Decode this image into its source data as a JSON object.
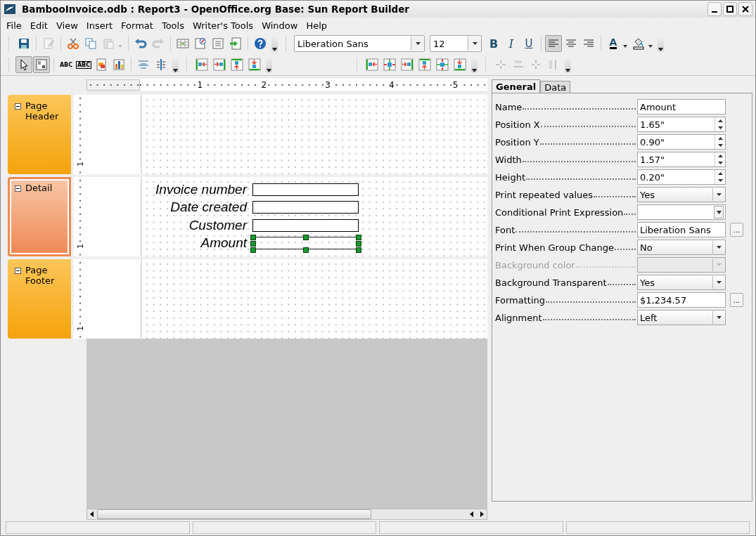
{
  "window": {
    "title": "BambooInvoice.odb : Report3 - OpenOffice.org Base: Sun Report Builder"
  },
  "menu": [
    {
      "label": "File"
    },
    {
      "label": "Edit"
    },
    {
      "label": "View"
    },
    {
      "label": "Insert"
    },
    {
      "label": "Format"
    },
    {
      "label": "Tools"
    },
    {
      "label": "Writer's Tools"
    },
    {
      "label": "Window"
    },
    {
      "label": "Help"
    }
  ],
  "toolbars": [
    {
      "items": [
        {
          "kind": "grip"
        },
        {
          "kind": "save",
          "disabled": false,
          "selected": false
        },
        {
          "kind": "separator"
        },
        {
          "kind": "edit",
          "disabled": true,
          "selected": false
        },
        {
          "kind": "separator"
        },
        {
          "kind": "cut",
          "disabled": false,
          "selected": false
        },
        {
          "kind": "copy",
          "disabled": false,
          "selected": false
        },
        {
          "kind": "paste",
          "disabled": true,
          "selected": false,
          "dropdown": true
        },
        {
          "kind": "separator"
        },
        {
          "kind": "undo",
          "disabled": false,
          "selected": false
        },
        {
          "kind": "redo",
          "disabled": true,
          "selected": false
        },
        {
          "kind": "separator"
        },
        {
          "kind": "table",
          "disabled": false,
          "selected": false
        },
        {
          "kind": "navigator",
          "disabled": false,
          "selected": false
        },
        {
          "kind": "page",
          "disabled": false,
          "selected": false
        },
        {
          "kind": "import",
          "disabled": false,
          "selected": false
        },
        {
          "kind": "separator"
        },
        {
          "kind": "help",
          "disabled": false,
          "selected": false
        },
        {
          "kind": "more"
        },
        {
          "kind": "grip"
        },
        {
          "kind": "combo",
          "value": "Liberation Sans"
        },
        {
          "kind": "combo",
          "value": "12"
        },
        {
          "kind": "bold",
          "label": "B",
          "disabled": false,
          "selected": false
        },
        {
          "kind": "italic",
          "label": "I",
          "disabled": false,
          "selected": false
        },
        {
          "kind": "underline",
          "label": "U",
          "disabled": false,
          "selected": false
        },
        {
          "kind": "separator"
        },
        {
          "kind": "align-left",
          "disabled": false,
          "selected": true
        },
        {
          "kind": "align-center",
          "disabled": false,
          "selected": false
        },
        {
          "kind": "align-right",
          "disabled": false,
          "selected": false
        },
        {
          "kind": "separator"
        },
        {
          "kind": "font-color",
          "label": "A",
          "disabled": false,
          "selected": false,
          "dropdown": true
        },
        {
          "kind": "highlight",
          "disabled": false,
          "selected": false,
          "dropdown": true
        },
        {
          "kind": "more"
        }
      ]
    },
    {
      "items": [
        {
          "kind": "grip"
        },
        {
          "kind": "select",
          "disabled": false,
          "selected": true
        },
        {
          "kind": "group",
          "disabled": false,
          "selected": true
        },
        {
          "kind": "separator"
        },
        {
          "kind": "label",
          "label": "ABC",
          "disabled": false,
          "selected": false
        },
        {
          "kind": "field",
          "label": "ABC",
          "disabled": false,
          "selected": false
        },
        {
          "kind": "image",
          "disabled": false,
          "selected": false
        },
        {
          "kind": "chart",
          "disabled": false,
          "selected": false
        },
        {
          "kind": "separator"
        },
        {
          "kind": "center-lines",
          "disabled": false,
          "selected": false
        },
        {
          "kind": "vertical-lines",
          "disabled": false,
          "selected": false
        },
        {
          "kind": "more"
        },
        {
          "kind": "grip"
        },
        {
          "kind": "align-to-left",
          "disabled": false,
          "selected": false
        },
        {
          "kind": "align-to-right",
          "disabled": false,
          "selected": false
        },
        {
          "kind": "align-to-top",
          "disabled": false,
          "selected": false
        },
        {
          "kind": "align-to-bottom",
          "disabled": false,
          "selected": false
        },
        {
          "kind": "more"
        },
        {
          "kind": "spacer"
        },
        {
          "kind": "grip"
        },
        {
          "kind": "align-to-left",
          "disabled": false,
          "selected": false
        },
        {
          "kind": "shrink-width",
          "disabled": false,
          "selected": false
        },
        {
          "kind": "align-to-right",
          "disabled": false,
          "selected": false
        },
        {
          "kind": "align-to-top",
          "disabled": false,
          "selected": false
        },
        {
          "kind": "shrink-height",
          "disabled": false,
          "selected": false
        },
        {
          "kind": "align-to-bottom",
          "disabled": false,
          "selected": false
        },
        {
          "kind": "more"
        },
        {
          "kind": "grip"
        },
        {
          "kind": "join-horizontal",
          "disabled": true,
          "selected": false
        },
        {
          "kind": "equal-width",
          "disabled": true,
          "selected": false
        },
        {
          "kind": "join-vertical",
          "disabled": true,
          "selected": false
        },
        {
          "kind": "equal-height",
          "disabled": true,
          "selected": false
        },
        {
          "kind": "more"
        }
      ]
    }
  ],
  "ruler": {
    "marks": [
      "1",
      "2",
      "3",
      "4",
      "5"
    ]
  },
  "sections": [
    {
      "title": "Page Header",
      "expanded": true,
      "selected": false,
      "ruler_mark": "1"
    },
    {
      "title": "Detail",
      "expanded": true,
      "selected": true,
      "ruler_mark": "1",
      "controls": [
        {
          "label": "Invoice number",
          "selected": false
        },
        {
          "label": "Date created",
          "selected": false
        },
        {
          "label": "Customer",
          "selected": false
        },
        {
          "label": "Amount",
          "selected": true
        }
      ]
    },
    {
      "title": "Page Footer",
      "expanded": true,
      "selected": false,
      "ruler_mark": "1"
    }
  ],
  "properties": {
    "tabs": [
      {
        "label": "General",
        "selected": true
      },
      {
        "label": "Data",
        "selected": false
      }
    ],
    "rows": [
      {
        "label": "Name",
        "kind": "text",
        "value": "Amount",
        "disabled": false
      },
      {
        "label": "Position X",
        "kind": "spin",
        "value": "1.65\"",
        "disabled": false
      },
      {
        "label": "Position Y",
        "kind": "spin",
        "value": "0.90\"",
        "disabled": false
      },
      {
        "label": "Width",
        "kind": "spin",
        "value": "1.57\"",
        "disabled": false
      },
      {
        "label": "Height",
        "kind": "spin",
        "value": "0.20\"",
        "disabled": false
      },
      {
        "label": "Print repeated values",
        "kind": "list",
        "value": "Yes",
        "disabled": false
      },
      {
        "label": "Conditional Print Expression",
        "kind": "combo",
        "disabled": false
      },
      {
        "label": "Font",
        "kind": "browse",
        "value": "Liberation Sans",
        "button": "...",
        "disabled": false
      },
      {
        "label": "Print When Group Change",
        "kind": "list",
        "value": "No",
        "disabled": false
      },
      {
        "label": "Background color",
        "kind": "list",
        "disabled": true
      },
      {
        "label": "Background Transparent",
        "kind": "list",
        "value": "Yes",
        "disabled": false
      },
      {
        "label": "Formatting",
        "kind": "browse",
        "value": "$1,234.57",
        "button": "...",
        "disabled": false
      },
      {
        "label": "Alignment",
        "kind": "list",
        "value": "Left",
        "disabled": false
      }
    ]
  }
}
